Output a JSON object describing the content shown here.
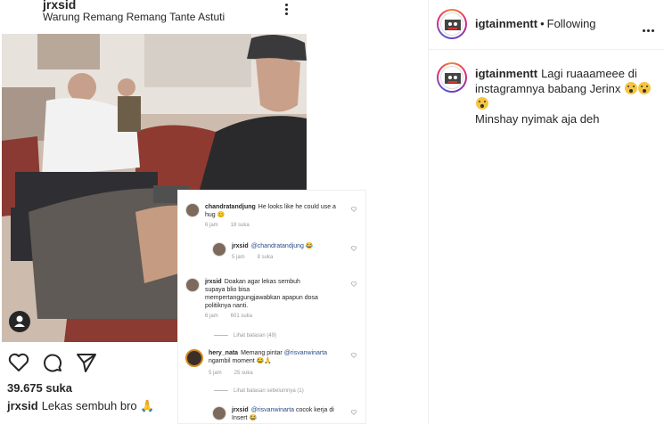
{
  "embedded_post": {
    "username": "jrxsid",
    "location": "Warung Remang Remang Tante Astuti",
    "likes": "39.675 suka",
    "caption_user": "jrxsid",
    "caption_text": "Lekas sembuh bro 🙏",
    "comments": [
      {
        "user": "chandratandjung",
        "text": "He looks like he could use a hug 😊",
        "time": "6 jam",
        "likes": "18 suka"
      },
      {
        "user": "jrxsid",
        "mention": "@chandratandjung",
        "text": "😂",
        "time": "5 jam",
        "likes": "8 suka"
      },
      {
        "user": "jrxsid",
        "text": "Doakan agar lekas sembuh supaya blio bisa mempertanggungjawabkan apapun dosa politiknya nanti.",
        "time": "6 jam",
        "likes": "601 suka"
      },
      {
        "view_replies": "Lihat balasan (49)"
      },
      {
        "user": "hery_nata",
        "text": "Memang pintar",
        "mention": "@risvanwinarta",
        "text2": "ngambil moment 😂🙏",
        "time": "5 jam",
        "likes": "25 suka"
      },
      {
        "view_replies": "Lihat balasan sebelumnya (1)"
      },
      {
        "user": "jrxsid",
        "mention": "@risvanwinarta",
        "text": "cocok kerja di Insert 😂"
      }
    ]
  },
  "side_panel": {
    "username": "igtainmentt",
    "separator": "•",
    "follow_status": "Following",
    "caption_user": "igtainmentt",
    "caption_text": "Lagi ruaaameee di instagramnya babang Jerinx",
    "caption_text2": "Minshay nyimak aja deh"
  },
  "icons": [
    "more-vertical-icon",
    "person-tag-icon",
    "heart-icon",
    "comment-icon",
    "share-icon",
    "more-horizontal-icon",
    "scream-emoji-icon"
  ],
  "colors": {
    "text": "#262626",
    "muted": "#999999",
    "mention": "#2a4a8a",
    "border": "#efefef",
    "story_ring": "#dd2a7b"
  }
}
